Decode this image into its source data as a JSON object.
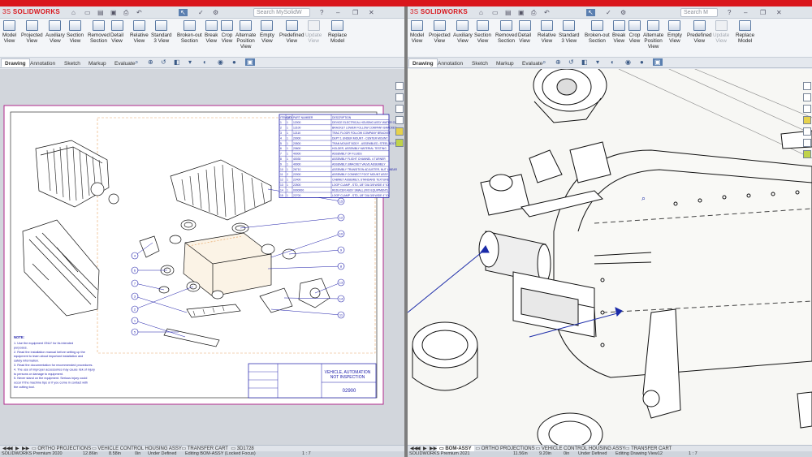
{
  "colors": {
    "accent": "#d9161c",
    "bom_blue": "#1a1aa8",
    "sheet_border": "#b02a8c"
  },
  "left": {
    "app_logo": "SOLIDWORKS",
    "search_placeholder": "Search MySolidW",
    "ribbon": [
      "Model\nView",
      "Projected\nView",
      "Auxiliary\nView",
      "Section\nView",
      "Removed\nSection",
      "Detail\nView",
      "Relative\nView",
      "Standard\n3 View",
      "Broken-out\nSection",
      "Break\nView",
      "Crop\nView",
      "Alternate\nPosition\nView",
      "Empty\nView",
      "Predefined\nView",
      "Update\nView",
      "Replace\nModel"
    ],
    "ribbon_disabled": [
      "Update\nView"
    ],
    "tabs": [
      "Drawing",
      "Annotation",
      "Sketch",
      "Markup",
      "Evaluate"
    ],
    "active_tab": "Drawing",
    "sheet": {
      "bom_headers": [
        "ITEM NO.",
        "QTY.",
        "PART NUMBER",
        "DESCRIPTION"
      ],
      "bom_rows": [
        [
          "1",
          "1",
          "12000",
          "DEVICE ELECTRICAL HOUSING ASSY WATER COOL"
        ],
        [
          "2",
          "1",
          "12100",
          "BRACKET LOWER FOLLOW COMPANY BRACKET"
        ],
        [
          "3",
          "1",
          "12110",
          "TRAC FLOOR FOLLOW COMPANY BRACKET"
        ],
        [
          "4",
          "1",
          "20000",
          "DEPT 1 UNDER MOUNT - CENTER MOUNT"
        ],
        [
          "5",
          "1",
          "20500",
          "TRAN MOUNT BODY - ASSEMBLED, STEEL BOLT"
        ],
        [
          "6",
          "1",
          "20600",
          "HOLDER, ASSEMBLY MATERIAL TESTING"
        ],
        [
          "7",
          "1",
          "40000",
          "ASSEMBLY OF FLUIDS"
        ],
        [
          "8",
          "1",
          "40030",
          "ASSEMBLY FLIGHT CHANNEL 4 TURNER"
        ],
        [
          "9",
          "1",
          "40000",
          "ASSEMBLY, BRACKET VALVE ASSEMBLY"
        ],
        [
          "10",
          "1",
          "26710",
          "ASSEMBLY TRANSITION ADJUSTER, NUT LINEAR"
        ],
        [
          "11",
          "2",
          "22000",
          "ASSEMBLY CONNECT FOOT MOUNT ASSY"
        ],
        [
          "12",
          "1",
          "22400",
          "CABINET ASSEMBLY, STANDARD TEXTURE"
        ],
        [
          "13",
          "1",
          "22500",
          "LOOP CLAMP - STD, 1/8\" DIA 3/8 WIDE 4\" ID"
        ],
        [
          "14",
          "1",
          "0000000",
          "REDUCER ASSY SMALL (R/O EQUIPMENT)"
        ],
        [
          "15",
          "1",
          "22700",
          "LOOP CLAMP - STD, 1/8\" DIA 3/8 WIDE 4\" ID"
        ]
      ],
      "balloons_left": [
        "4",
        "6",
        "7",
        "3",
        "2",
        "1",
        "5"
      ],
      "balloons_right": [
        "15",
        "12",
        "10",
        "9",
        "8",
        "13",
        "14",
        "11"
      ],
      "notes_title": "NOTE:",
      "notes": [
        "1.  Use the equipment ONLY for its intended",
        "     purposes.",
        "2.  Read the installation manual before setting up the",
        "     equipment to learn about important installation and",
        "     safety information.",
        "3.  Read the documentation for recommended procedures.",
        "4.  The use of improper accessories may cause risk of injury",
        "     to persons or damage to equipment.",
        "5.  Never stand on the equipment. Serious injury could",
        "     occur if the machine tips or if you come in contact with",
        "     the cutting tool."
      ],
      "title_block": "VEHICLE, AUTOMATION\nNOT INSPECTION",
      "dwg_no": "02900"
    },
    "sheet_tabs": [
      "ORTHO PROJECTIONS",
      "VEHICLE CONTROL HOUSING ASSY",
      "TRANSFER CART",
      "3D1728"
    ],
    "status": {
      "product": "SOLIDWORKS Premium 2020",
      "x": "12.86in",
      "y": "8.58in",
      "z": "0in",
      "state": "Under Defined",
      "editing": "Editing BOM-ASSY (Locked Focus)",
      "scale": "1 : 7"
    }
  },
  "right": {
    "app_logo": "SOLIDWORKS",
    "search_placeholder": "Search M",
    "ribbon": [
      "Model\nView",
      "Projected\nView",
      "Auxiliary\nView",
      "Section\nView",
      "Removed\nSection",
      "Detail\nView",
      "Relative\nView",
      "Standard\n3 View",
      "Broken-out\nSection",
      "Break\nView",
      "Crop\nView",
      "Alternate\nPosition\nView",
      "Empty\nView",
      "Predefined\nView",
      "Update\nView",
      "Replace\nModel"
    ],
    "ribbon_disabled": [
      "Update\nView"
    ],
    "tabs": [
      "Drawing",
      "Annotation",
      "Sketch",
      "Markup",
      "Evaluate"
    ],
    "active_tab": "Drawing",
    "sheet_tabs": [
      "BOM-ASSY",
      "ORTHO PROJECTIONS",
      "VEHICLE CONTROL HOUSING ASSY",
      "TRANSFER CART"
    ],
    "active_sheet": "BOM-ASSY",
    "status": {
      "product": "SOLIDWORKS Premium 2021",
      "x": "11.56in",
      "y": "9.20in",
      "z": "0in",
      "state": "Under Defined",
      "editing": "Editing Drawing View12",
      "scale": "1 : 7"
    }
  }
}
